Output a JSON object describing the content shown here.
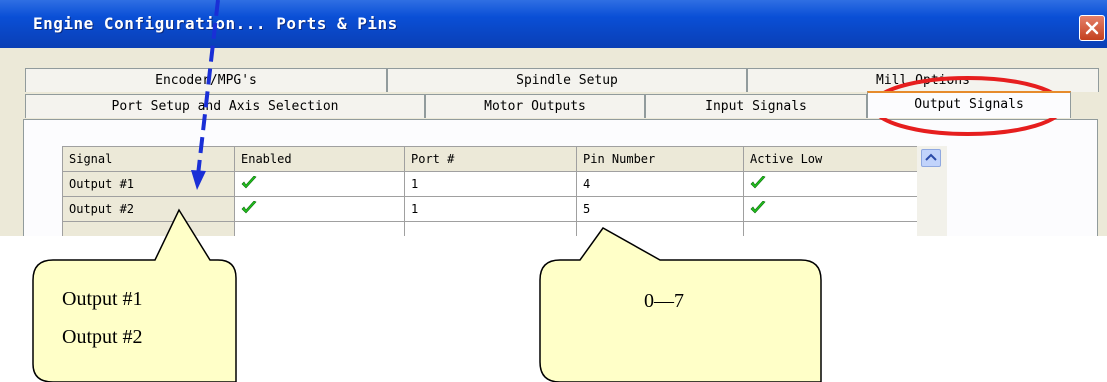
{
  "window": {
    "title": "Engine Configuration... Ports & Pins"
  },
  "tabs_row1": [
    "Encoder/MPG's",
    "Spindle Setup",
    "Mill Options"
  ],
  "tabs_row2": [
    "Port Setup and Axis Selection",
    "Motor Outputs",
    "Input Signals",
    "Output Signals"
  ],
  "active_tab": "Output Signals",
  "table": {
    "headers": [
      "Signal",
      "Enabled",
      "Port #",
      "Pin Number",
      "Active Low"
    ],
    "rows": [
      {
        "signal": "Output #1",
        "enabled": true,
        "port": "1",
        "pin": "4",
        "active_low": true
      },
      {
        "signal": "Output #2",
        "enabled": true,
        "port": "1",
        "pin": "5",
        "active_low": true
      }
    ]
  },
  "callouts": {
    "left": [
      "Output #1",
      "Output #2"
    ],
    "right": "0—7"
  },
  "colors": {
    "title_bar": "#0a46c4",
    "highlight_ellipse": "#e61e1e",
    "arrow": "#1a2fd6",
    "callout_fill": "#ffffc8",
    "check": "#22c21e"
  }
}
